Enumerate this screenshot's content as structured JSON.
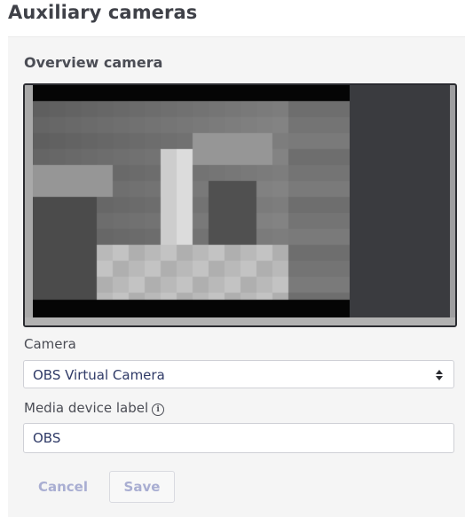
{
  "page": {
    "title": "Auxiliary cameras"
  },
  "overview": {
    "section_title": "Overview camera"
  },
  "camera": {
    "label": "Camera",
    "selected": "OBS Virtual Camera",
    "arrows_icon": "up-down-arrows-icon"
  },
  "media_label": {
    "label": "Media device label",
    "info_icon": "info-icon",
    "info_glyph": "i",
    "value": "OBS"
  },
  "actions": {
    "cancel_label": "Cancel",
    "save_label": "Save"
  },
  "colors": {
    "title": "#3f4148",
    "panel_bg": "#f5f5f5",
    "input_text": "#2f3a67",
    "button_text": "#a9aed2",
    "preview_border": "#2b2c31"
  }
}
